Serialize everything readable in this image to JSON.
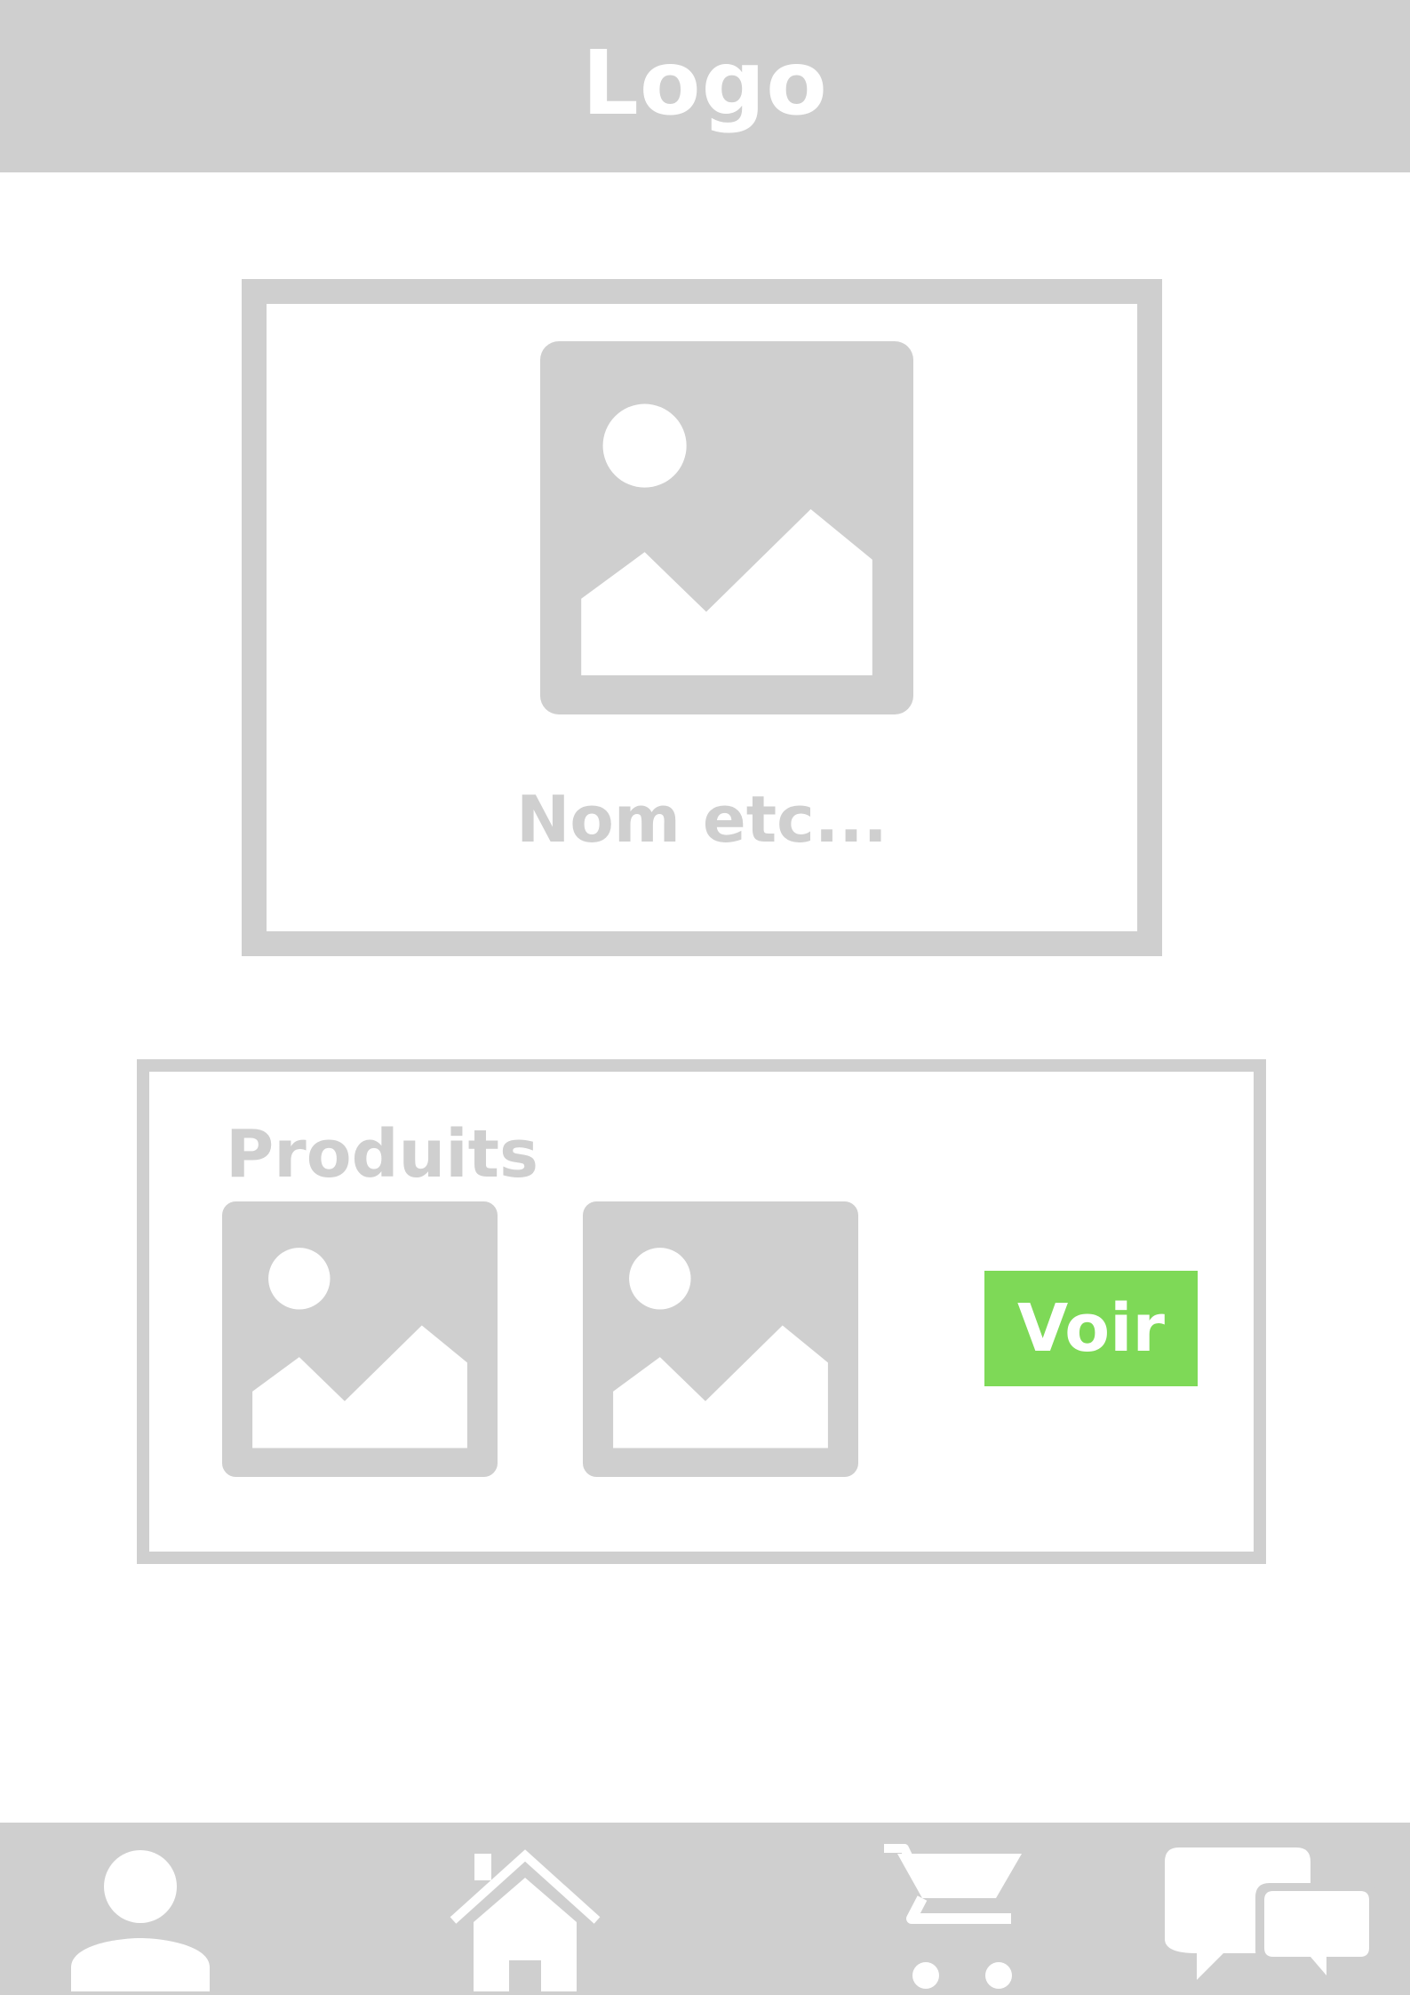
{
  "header": {
    "logo_text": "Logo"
  },
  "featured": {
    "image_icon": "image-placeholder-icon",
    "caption": "Nom etc..."
  },
  "products": {
    "title": "Produits",
    "thumbnails": [
      {
        "icon": "image-placeholder-icon"
      },
      {
        "icon": "image-placeholder-icon"
      }
    ],
    "button_label": "Voir"
  },
  "bottom_nav": {
    "items": [
      {
        "icon": "user-icon"
      },
      {
        "icon": "home-icon"
      },
      {
        "icon": "cart-icon"
      },
      {
        "icon": "chat-icon"
      }
    ]
  },
  "colors": {
    "placeholder_gray": "#cfcfcf",
    "accent_green": "#7ed957",
    "background": "#ffffff"
  }
}
